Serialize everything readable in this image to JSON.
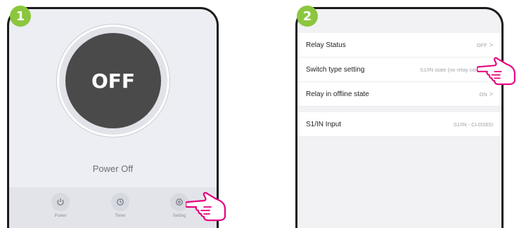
{
  "steps": [
    "1",
    "2"
  ],
  "screen1": {
    "knob_label": "OFF",
    "status_text": "Power Off",
    "buttons": [
      {
        "label": "Power",
        "icon": "power-icon"
      },
      {
        "label": "Timer",
        "icon": "timer-icon"
      },
      {
        "label": "Setting",
        "icon": "setting-icon"
      }
    ]
  },
  "screen2": {
    "rows": [
      {
        "label": "Relay Status",
        "value": "OFF",
        "chevron": ">"
      },
      {
        "label": "Switch type setting",
        "value": "S1/IN state (no relay control)",
        "chevron": ">"
      },
      {
        "label": "Relay in offline state",
        "value": "ON",
        "chevron": ">"
      },
      {
        "label": "S1/IN Input",
        "value": "S1/IN - CLOSED",
        "chevron": ""
      }
    ]
  },
  "colors": {
    "badge": "#8cc63f",
    "knob": "#4a4a4a",
    "pointer_outline": "#e6007e"
  }
}
